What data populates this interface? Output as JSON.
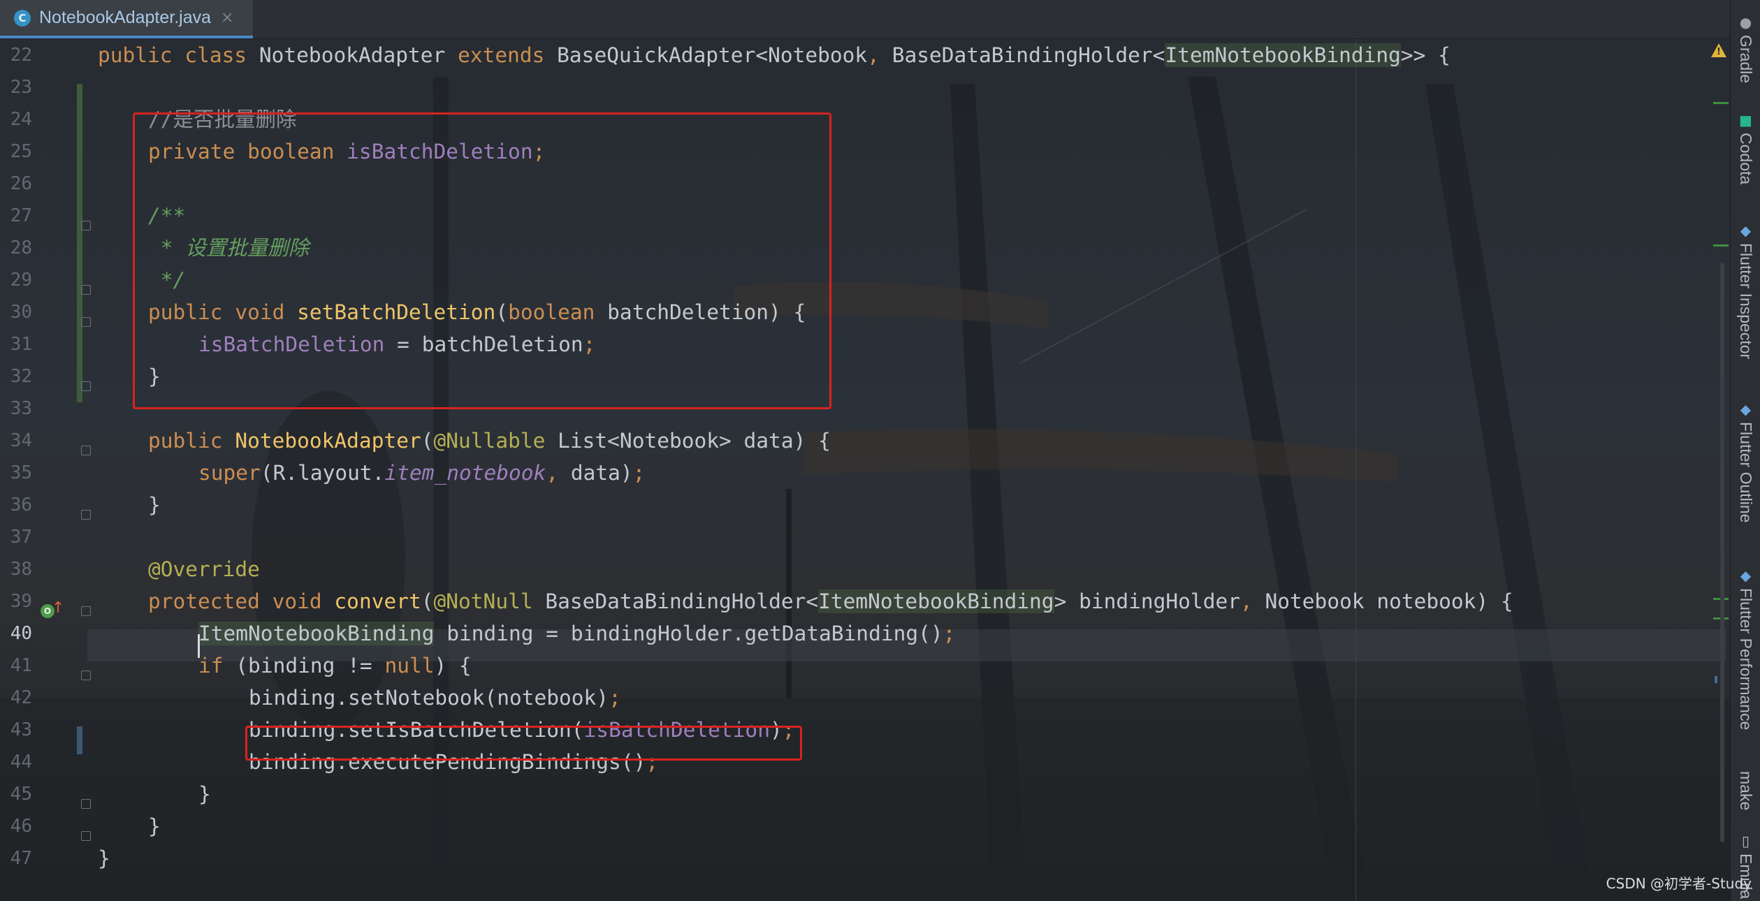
{
  "tab": {
    "icon_letter": "C",
    "label": "NotebookAdapter.java",
    "close": "×"
  },
  "gutter": {
    "line_numbers": [
      "22",
      "23",
      "24",
      "25",
      "26",
      "27",
      "28",
      "29",
      "30",
      "31",
      "32",
      "33",
      "34",
      "35",
      "36",
      "37",
      "38",
      "39",
      "40",
      "41",
      "42",
      "43",
      "44",
      "45",
      "46",
      "47"
    ],
    "current_line": "40",
    "override_icon_letter": "O",
    "override_arrow": "↑"
  },
  "code": {
    "l22": {
      "kw1": "public class ",
      "name": "NotebookAdapter ",
      "kw2": "extends ",
      "base": "BaseQuickAdapter<Notebook",
      "sep": ", ",
      "holder": "BaseDataBindingHolder<",
      "binding": "ItemNotebookBinding",
      "end": ">> {"
    },
    "l24": {
      "comment": "//是否批量删除"
    },
    "l25": {
      "kw": "private boolean ",
      "field": "isBatchDeletion",
      "semi": ";"
    },
    "l27": {
      "doc": "/**"
    },
    "l28": {
      "doc": " * 设置批量删除"
    },
    "l29": {
      "doc": " */"
    },
    "l30": {
      "kw": "public void ",
      "fn": "setBatchDeletion",
      "open": "(",
      "kw2": "boolean ",
      "rest": "batchDeletion) {"
    },
    "l31": {
      "field": "isBatchDeletion",
      "rest": " = batchDeletion",
      "semi": ";"
    },
    "l32": {
      "text": "}"
    },
    "l34": {
      "kw": "public ",
      "fn": "NotebookAdapter",
      "open": "(",
      "annot": "@Nullable ",
      "rest": "List<Notebook> data) {"
    },
    "l35": {
      "kw": "super",
      "pre": "(R.layout.",
      "static": "item_notebook",
      "sep": ", ",
      "rest": "data)",
      "semi": ";"
    },
    "l36": {
      "text": "}"
    },
    "l38": {
      "annot": "@Override"
    },
    "l39": {
      "kw": "protected void ",
      "fn": "convert",
      "open": "(",
      "annot": "@NotNull ",
      "type1": "BaseDataBindingHolder<",
      "binding": "ItemNotebookBinding",
      "type2": "> bindingHolder",
      "sep": ", ",
      "rest": "Notebook notebook) {"
    },
    "l40": {
      "binding": "ItemNotebookBinding",
      "rest": " binding = bindingHolder.getDataBinding()",
      "semi": ";"
    },
    "l41": {
      "kw": "if ",
      "mid": "(binding != ",
      "kw2": "null",
      "rest": ") {"
    },
    "l42": {
      "text": "binding.setNotebook(notebook)",
      "semi": ";"
    },
    "l43": {
      "pre": "binding.setIsBatchDeletion(",
      "field": "isBatchDeletion",
      "close": ")",
      "semi": ";"
    },
    "l44": {
      "text": "binding.executePendingBindings()",
      "semi": ";"
    },
    "l45": {
      "text": "}"
    },
    "l46": {
      "text": "}"
    },
    "l47": {
      "text": "}"
    }
  },
  "side_panel": {
    "items": [
      "Gradle",
      "Codota",
      "Flutter Inspector",
      "Flutter Outline",
      "Flutter Performance",
      "make",
      "Emula"
    ]
  },
  "warning_mark": "!",
  "watermark": "CSDN @初学者-Study",
  "colors": {
    "keyword": "#cc8e52",
    "function": "#f0c468",
    "field": "#9f7fbd",
    "doc_comment": "#659e5e",
    "annotation": "#b5b054",
    "highlight_box": "#d8231f",
    "tab_accent": "#4a88c7"
  }
}
